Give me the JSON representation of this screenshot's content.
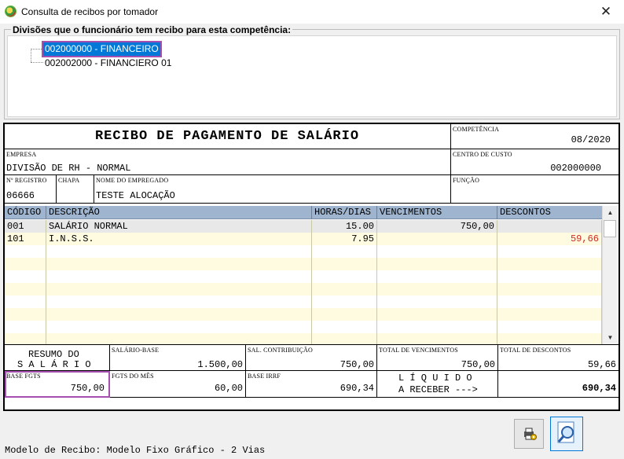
{
  "window": {
    "title": "Consulta de recibos por tomador",
    "close_glyph": "✕"
  },
  "divisions": {
    "group_title": "Divisões que o funcionário tem recibo para esta competência:",
    "items": [
      {
        "label": "002000000 - FINANCEIRO",
        "selected": true
      },
      {
        "label": "002002000 - FINANCIERO 01",
        "selected": false
      }
    ]
  },
  "receipt": {
    "title": "RECIBO DE PAGAMENTO DE SALÁRIO",
    "competencia": {
      "label": "COMPETÊNCIA",
      "value": "08/2020"
    },
    "empresa": {
      "label": "EMPRESA",
      "value": "DIVISÃO DE RH - NORMAL"
    },
    "centro_custo": {
      "label": "CENTRO DE CUSTO",
      "value": "002000000"
    },
    "registro": {
      "label": "Nº REGISTRO",
      "value": "06666"
    },
    "chapa": {
      "label": "CHAPA",
      "value": ""
    },
    "nome": {
      "label": "NOME DO EMPREGADO",
      "value": "TESTE ALOCAÇÃO"
    },
    "funcao": {
      "label": "FUNÇÃO",
      "value": ""
    },
    "columns": [
      "CÓDIGO",
      "DESCRIÇÃO",
      "HORAS/DIAS",
      "VENCIMENTOS",
      "DESCONTOS"
    ],
    "rows": [
      {
        "codigo": "001",
        "descricao": "SALÁRIO NORMAL",
        "horas": "15.00",
        "vencimentos": "750,00",
        "descontos": ""
      },
      {
        "codigo": "101",
        "descricao": "I.N.S.S.",
        "horas": "7.95",
        "vencimentos": "",
        "descontos": "59,66"
      }
    ],
    "resumo": {
      "line1": "RESUMO DO",
      "line2": "S A L Á R I O"
    },
    "salario_base": {
      "label": "SALÁRIO-BASE",
      "value": "1.500,00"
    },
    "sal_contribuicao": {
      "label": "SAL. CONTRIBUIÇÃO",
      "value": "750,00"
    },
    "total_vencimentos": {
      "label": "TOTAL DE VENCIMENTOS",
      "value": "750,00"
    },
    "total_descontos": {
      "label": "TOTAL DE DESCONTOS",
      "value": "59,66"
    },
    "base_fgts": {
      "label": "BASE FGTS",
      "value": "750,00"
    },
    "fgts_mes": {
      "label": "FGTS DO MÊS",
      "value": "60,00"
    },
    "base_irrf": {
      "label": "BASE IRRF",
      "value": "690,34"
    },
    "liquido": {
      "line1": "L Í Q U I D O",
      "line2": "A RECEBER --->",
      "value": "690,34"
    }
  },
  "status_bar": {
    "text": "Modelo de Recibo: Modelo Fixo Gráfico - 2 Vias"
  },
  "colors": {
    "selection": "#0078d7",
    "highlight_border": "#a64fb0",
    "header": "#9fb5cf",
    "row_even": "#fffbe1",
    "row_first": "#e8e8e8",
    "discount": "#d2281e"
  }
}
